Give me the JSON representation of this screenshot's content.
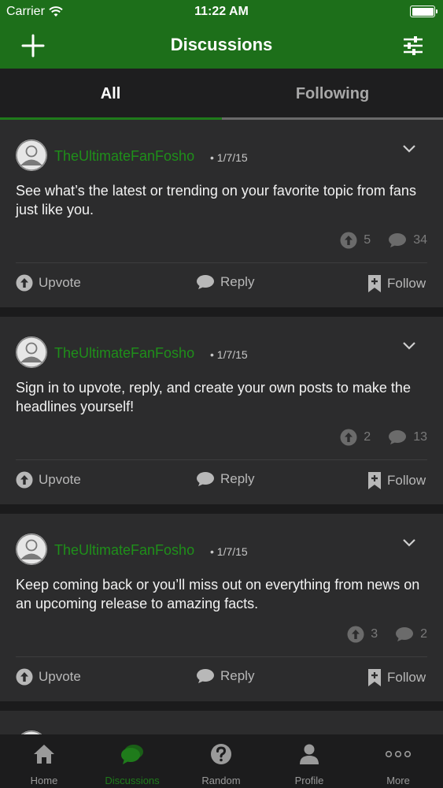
{
  "status_bar": {
    "carrier": "Carrier",
    "time": "11:22 AM"
  },
  "nav": {
    "title": "Discussions",
    "add_icon": "plus-icon",
    "filter_icon": "sliders-icon"
  },
  "tabs": [
    {
      "label": "All",
      "active": true
    },
    {
      "label": "Following",
      "active": false
    }
  ],
  "posts": [
    {
      "author": "TheUltimateFanFosho",
      "date": "• 1/7/15",
      "text": "See what’s the latest or trending on your favorite topic from fans just like you.",
      "upvotes": "5",
      "replies": "34"
    },
    {
      "author": "TheUltimateFanFosho",
      "date": "• 1/7/15",
      "text": "Sign in to upvote, reply, and create your own posts to make the headlines yourself!",
      "upvotes": "2",
      "replies": "13"
    },
    {
      "author": "TheUltimateFanFosho",
      "date": "• 1/7/15",
      "text": "Keep coming back or you’ll miss out on everything from news on an upcoming release to amazing facts.",
      "upvotes": "3",
      "replies": "2"
    }
  ],
  "actions": {
    "upvote": "Upvote",
    "reply": "Reply",
    "follow": "Follow"
  },
  "tab_bar": [
    {
      "label": "Home",
      "icon": "home-icon",
      "active": false
    },
    {
      "label": "Discussions",
      "icon": "chat-bubbles-icon",
      "active": true
    },
    {
      "label": "Random",
      "icon": "question-icon",
      "active": false
    },
    {
      "label": "Profile",
      "icon": "person-icon",
      "active": false
    },
    {
      "label": "More",
      "icon": "more-dots-icon",
      "active": false
    }
  ],
  "colors": {
    "brand_green": "#1d6f1a",
    "author_green": "#1f8f1a",
    "background": "#1b1b1c",
    "card": "#2c2c2d"
  }
}
